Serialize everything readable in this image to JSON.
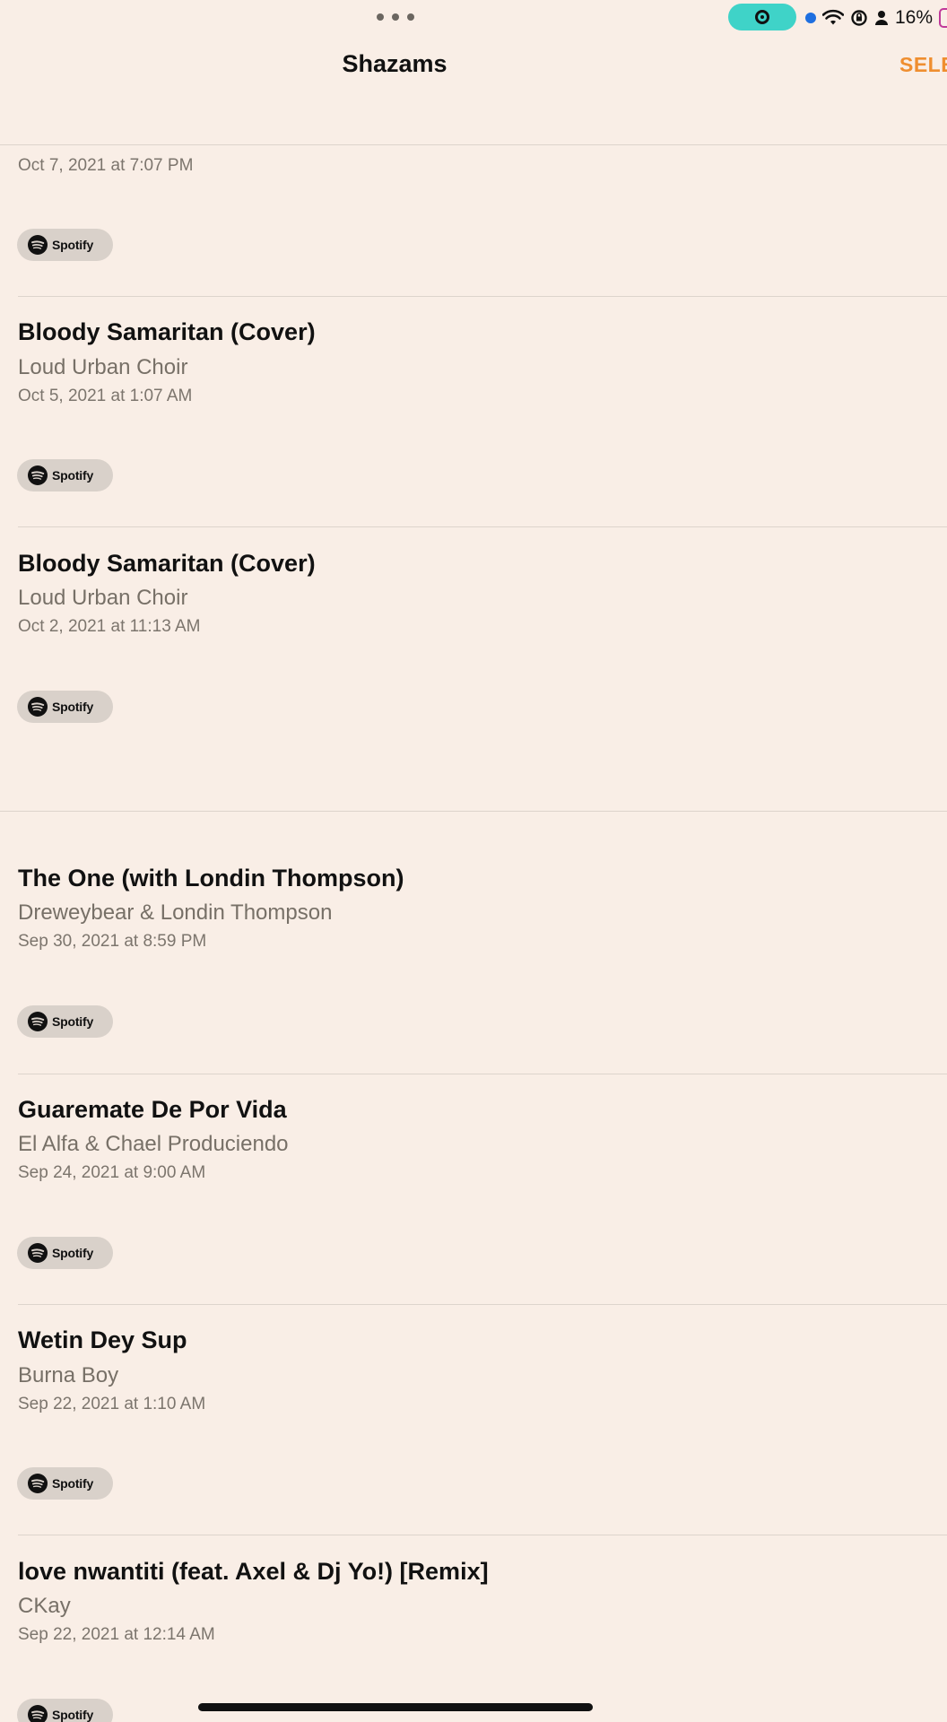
{
  "status_bar": {
    "battery_percent": "16%",
    "icons": [
      "multitask-dots-icon",
      "screen-recording-icon",
      "location-dot-icon",
      "wifi-icon",
      "orientation-lock-icon",
      "person-icon",
      "battery-icon"
    ],
    "colors": {
      "recording_pill": "#3fd3c8",
      "location_dot": "#1e6fe0",
      "battery_outline": "#c0399a"
    }
  },
  "header": {
    "title": "Shazams",
    "select_label": "SELE"
  },
  "colors": {
    "background": "#f9eee6",
    "accent": "#ef8e2f",
    "title_text": "#111111",
    "secondary_text": "#777067",
    "button_bg": "#d9d1ca"
  },
  "tracks": [
    {
      "title": "",
      "artist": "",
      "date": "Oct 7, 2021 at 7:07 PM",
      "service": "Spotify"
    },
    {
      "title": "Bloody Samaritan (Cover)",
      "artist": "Loud Urban Choir",
      "date": "Oct 5, 2021 at 1:07 AM",
      "service": "Spotify"
    },
    {
      "title": "Bloody Samaritan (Cover)",
      "artist": "Loud Urban Choir",
      "date": "Oct 2, 2021 at 11:13 AM",
      "service": "Spotify"
    },
    {
      "title": "The One (with Londin Thompson)",
      "artist": "Dreweybear & Londin Thompson",
      "date": "Sep 30, 2021 at 8:59 PM",
      "service": "Spotify"
    },
    {
      "title": "Guaremate De Por Vida",
      "artist": "El Alfa & Chael Produciendo",
      "date": "Sep 24, 2021 at 9:00 AM",
      "service": "Spotify"
    },
    {
      "title": "Wetin Dey Sup",
      "artist": "Burna Boy",
      "date": "Sep 22, 2021 at 1:10 AM",
      "service": "Spotify"
    },
    {
      "title": "love nwantiti (feat. Axel & Dj Yo!) [Remix]",
      "artist": "CKay",
      "date": "Sep 22, 2021 at 12:14 AM",
      "service": "Spotify"
    }
  ]
}
